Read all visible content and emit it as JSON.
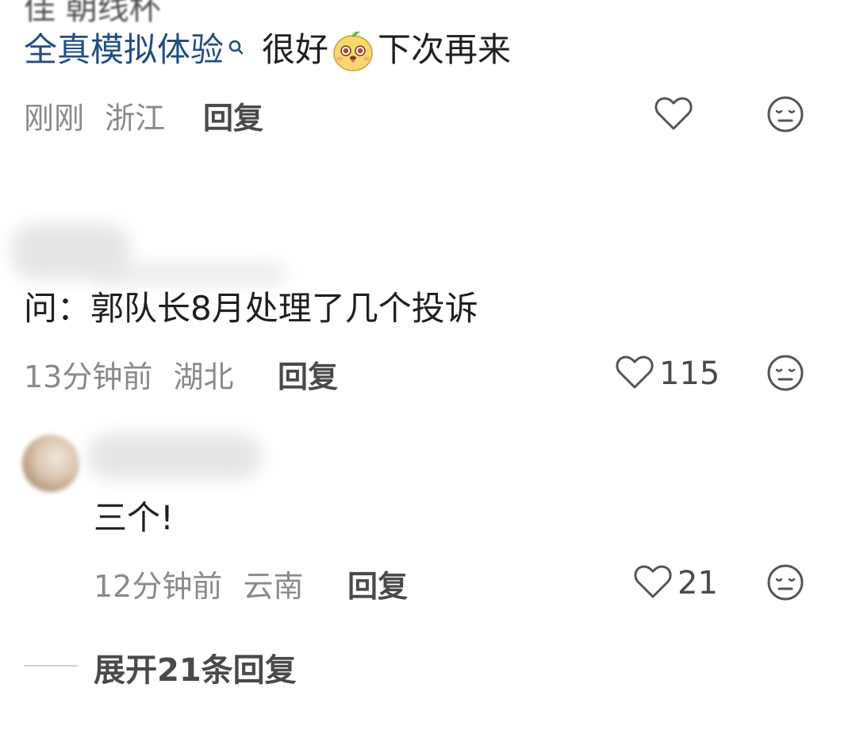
{
  "top_cutoff": {
    "text": "佳  朝线杯"
  },
  "comments": [
    {
      "link_text": "全真模拟体验",
      "text_mid": "很好",
      "text_end": "下次再来",
      "emoji_icon": "cute-face-emoji",
      "time": "刚刚",
      "location": "浙江",
      "reply_label": "回复",
      "likes": ""
    },
    {
      "text": "问：郭队长8月处理了几个投诉",
      "time": "13分钟前",
      "location": "湖北",
      "reply_label": "回复",
      "likes": "115"
    },
    {
      "text": "三个!",
      "time": "12分钟前",
      "location": "云南",
      "reply_label": "回复",
      "likes": "21"
    }
  ],
  "expand": {
    "label": "展开21条回复"
  },
  "icons": {
    "like": "heart-outline-icon",
    "dislike": "meh-face-icon",
    "search": "search-icon"
  },
  "colors": {
    "link": "#1f4e86",
    "meta": "#8a8a8a",
    "icon": "#555555"
  }
}
